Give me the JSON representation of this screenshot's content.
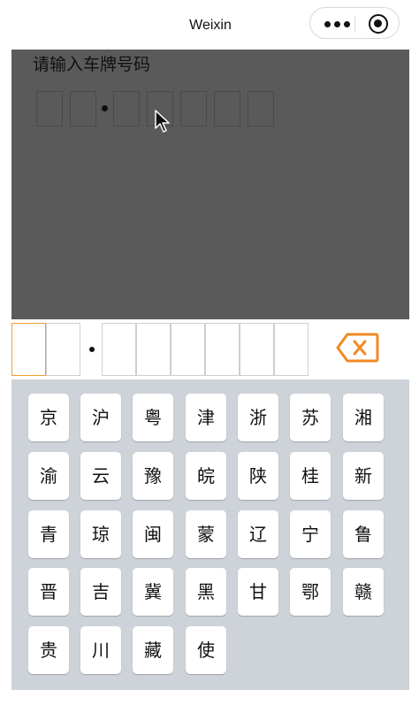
{
  "nav": {
    "title": "Weixin"
  },
  "prompt": "请输入车牌号码",
  "keyboard": {
    "rows": [
      [
        "京",
        "沪",
        "粤",
        "津",
        "浙",
        "苏",
        "湘"
      ],
      [
        "渝",
        "云",
        "豫",
        "皖",
        "陕",
        "桂",
        "新"
      ],
      [
        "青",
        "琼",
        "闽",
        "蒙",
        "辽",
        "宁",
        "鲁"
      ],
      [
        "晋",
        "吉",
        "冀",
        "黑",
        "甘",
        "鄂",
        "赣"
      ],
      [
        "贵",
        "川",
        "藏",
        "使"
      ]
    ]
  },
  "colors": {
    "accent": "#f0a030",
    "backspace": "#f08a24",
    "overlay": "#5a5a5a",
    "keyboard_bg": "#ced2d9"
  }
}
